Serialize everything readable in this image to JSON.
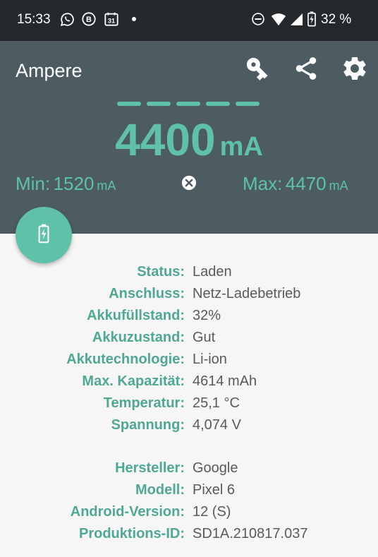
{
  "status_bar": {
    "time": "15:33",
    "battery_percent": "32 %",
    "icons": [
      "whatsapp-icon",
      "b-app-icon",
      "calendar-icon",
      "dot-icon",
      "dnd-icon",
      "wifi-icon",
      "signal-icon",
      "battery-charging-icon"
    ],
    "calendar_day": "31"
  },
  "toolbar": {
    "title": "Ampere",
    "actions": [
      "key-icon",
      "share-icon",
      "settings-icon"
    ]
  },
  "meter": {
    "current_value": "4400",
    "current_unit": "mA",
    "min_label": "Min:",
    "min_value": "1520",
    "min_unit": "mA",
    "max_label": "Max:",
    "max_value": "4470",
    "max_unit": "mA",
    "level_dashes": 5
  },
  "colors": {
    "accent": "#5fc1a7",
    "header_bg": "#4d5b63",
    "status_bar_bg": "#25292c",
    "label_color": "#4fa892",
    "value_color": "#5a5a5a",
    "body_bg": "#f6f6f6"
  },
  "battery_info": [
    {
      "label": "Status:",
      "value": "Laden"
    },
    {
      "label": "Anschluss:",
      "value": "Netz-Ladebetrieb"
    },
    {
      "label": "Akkufüllstand:",
      "value": "32%"
    },
    {
      "label": "Akkuzustand:",
      "value": "Gut"
    },
    {
      "label": "Akkutechnologie:",
      "value": "Li-ion"
    },
    {
      "label": "Max. Kapazität:",
      "value": "4614 mAh"
    },
    {
      "label": "Temperatur:",
      "value": "25,1 °C"
    },
    {
      "label": "Spannung:",
      "value": "4,074 V"
    }
  ],
  "device_info": [
    {
      "label": "Hersteller:",
      "value": "Google"
    },
    {
      "label": "Modell:",
      "value": "Pixel 6"
    },
    {
      "label": "Android-Version:",
      "value": "12 (S)"
    },
    {
      "label": "Produktions-ID:",
      "value": "SD1A.210817.037"
    }
  ]
}
